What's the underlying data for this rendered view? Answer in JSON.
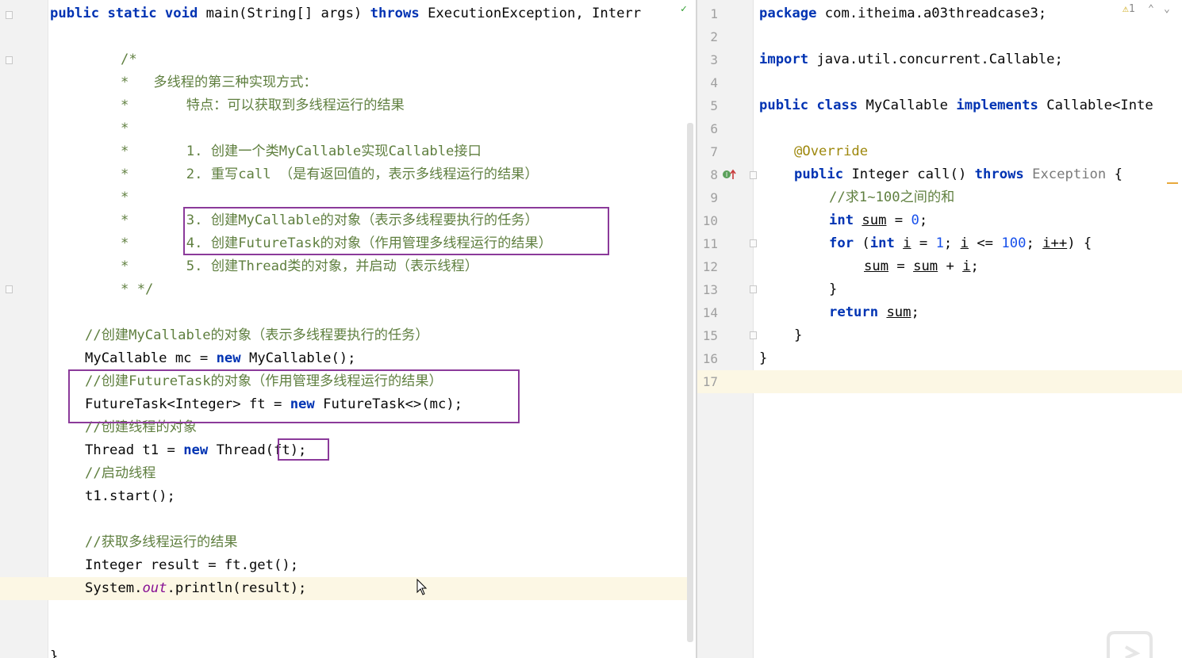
{
  "left_editor": {
    "signature": {
      "public": "public",
      "static": "static",
      "void": "void",
      "rest": " main(String[] args) ",
      "throws": "throws",
      "exceptions": " ExecutionException, Interr"
    },
    "doc_comment": [
      "/*",
      "*   多线程的第三种实现方式：",
      "*       特点：可以获取到多线程运行的结果",
      "*",
      "*       1. 创建一个类MyCallable实现Callable接口",
      "*       2. 重写call （是有返回值的，表示多线程运行的结果）",
      "*",
      "*       3. 创建MyCallable的对象（表示多线程要执行的任务）",
      "*       4. 创建FutureTask的对象（作用管理多线程运行的结果）",
      "*       5. 创建Thread类的对象，并启动（表示线程）",
      "* */"
    ],
    "body": {
      "c1": "//创建MyCallable的对象（表示多线程要执行的任务）",
      "l1_a": "MyCallable mc = ",
      "new": "new",
      "l1_b": " MyCallable();",
      "c2": "//创建FutureTask的对象（作用管理多线程运行的结果）",
      "l2_a": "FutureTask<Integer> ft = ",
      "l2_b": " FutureTask<>(mc);",
      "c3": "//创建线程的对象",
      "l3_a": "Thread t1 = ",
      "l3_b": " Thread(ft);",
      "c4": "//启动线程",
      "l4": "t1.start();",
      "c5": "//获取多线程运行的结果",
      "l5": "Integer result = ft.get();",
      "l6_a": "System.",
      "l6_out": "out",
      "l6_b": ".println(result);",
      "closing": "}"
    }
  },
  "right_editor": {
    "line_numbers": [
      "1",
      "2",
      "3",
      "4",
      "5",
      "6",
      "7",
      "8",
      "9",
      "10",
      "11",
      "12",
      "13",
      "14",
      "15",
      "16",
      "17"
    ],
    "warning_count": "1",
    "package_kw": "package",
    "package_name": " com.itheima.a03threadcase3;",
    "import_kw": "import",
    "import_name": " java.util.concurrent.Callable;",
    "public": "public",
    "class": "class",
    "class_name": " MyCallable ",
    "implements": "implements",
    "iface": " Callable<Inte",
    "override": "@Override",
    "method_rest": " Integer call() ",
    "throws": "throws",
    "exception": " Exception",
    "brace_open": " {",
    "comment": "//求1~100之间的和",
    "int": "int",
    "sum": "sum",
    "eq": " = ",
    "zero": "0",
    "semi": ";",
    "for": "for",
    "paren_open": " (",
    "i": "i",
    "one": "1",
    "le": " <= ",
    "hundred": "100",
    "semi_sp": "; ",
    "ipp": "i++",
    "paren_close": ") {",
    "sum_line_mid": " = ",
    "plus": " + ",
    "close_brace": "}",
    "return": "return"
  },
  "colors": {
    "keyword": "#0033b3",
    "comment": "#5f7f3f",
    "highlight_box": "#8b3a9a",
    "caret_line": "#fcf7e4"
  }
}
